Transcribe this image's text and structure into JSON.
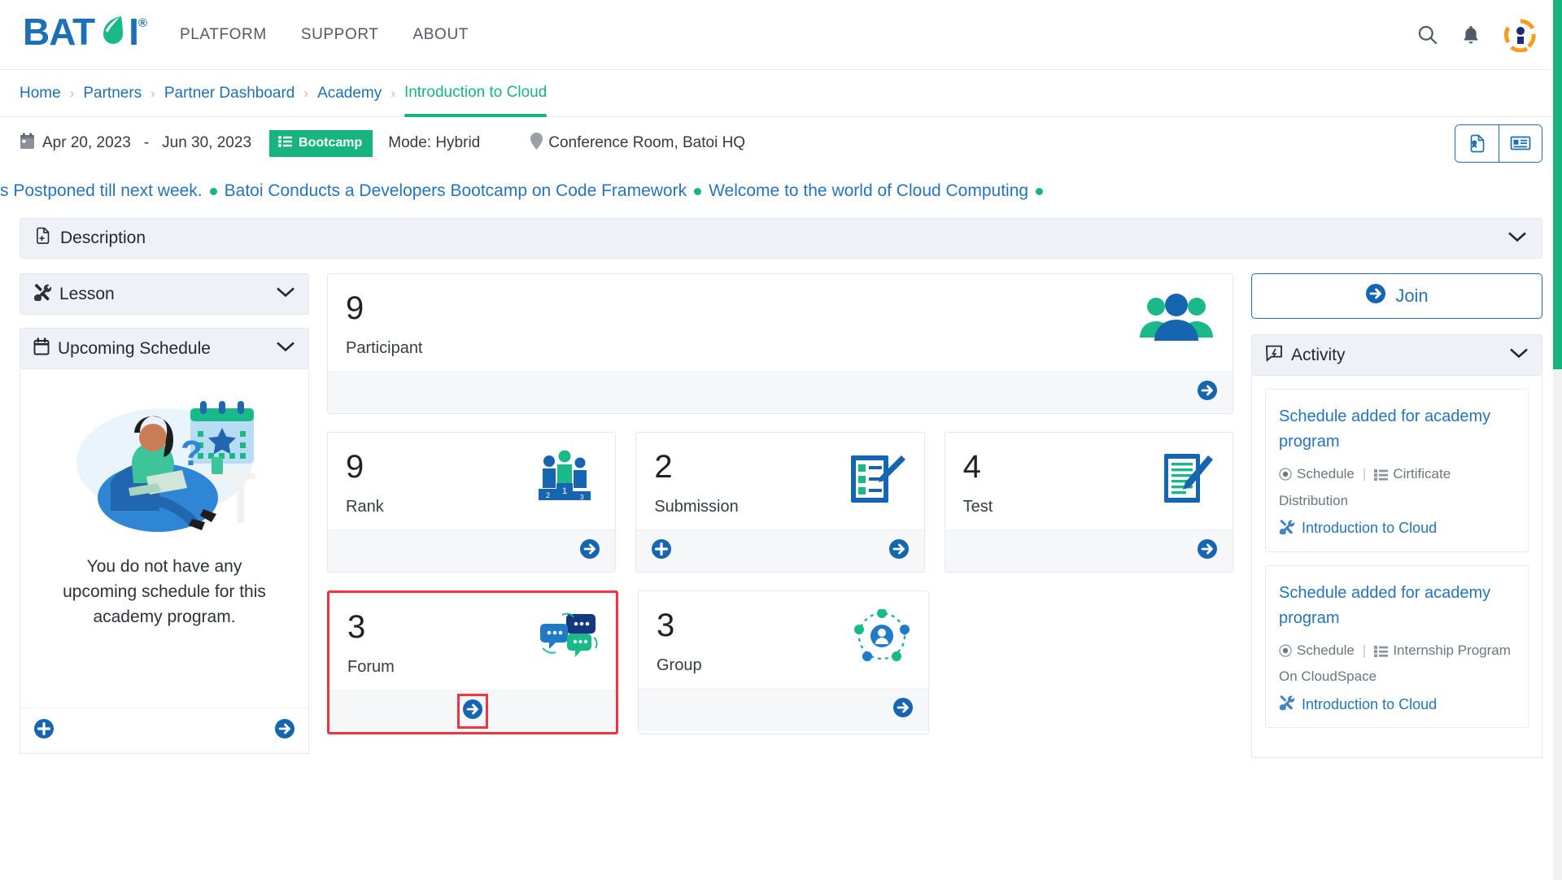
{
  "brand": {
    "name": "BATOI",
    "registered": "®"
  },
  "topnav": {
    "links": [
      {
        "label": "PLATFORM",
        "name": "nav-platform"
      },
      {
        "label": "SUPPORT",
        "name": "nav-support"
      },
      {
        "label": "ABOUT",
        "name": "nav-about"
      }
    ],
    "icons": {
      "search": "search-icon",
      "notification": "bell-icon",
      "avatar": "user-avatar"
    }
  },
  "breadcrumb": {
    "items": [
      "Home",
      "Partners",
      "Partner Dashboard",
      "Academy",
      "Introduction to Cloud"
    ],
    "separator": "›",
    "active_index": 4
  },
  "meta": {
    "start_date": "Apr 20, 2023",
    "dash": "-",
    "end_date": "Jun 30, 2023",
    "badge": "Bootcamp",
    "mode": "Mode: Hybrid",
    "location": "Conference Room, Batoi HQ",
    "actions": [
      {
        "name": "certificate-button",
        "icon": "certificate-icon"
      },
      {
        "name": "newsletter-button",
        "icon": "newspaper-icon"
      }
    ]
  },
  "ticker": {
    "items": [
      "s Postponed till next week.",
      "Batoi Conducts a Developers Bootcamp on Code Framework",
      "Welcome to the world of Cloud Computing"
    ]
  },
  "description_panel": {
    "title": "Description",
    "icon": "file-plus-icon"
  },
  "lesson_panel": {
    "title": "Lesson",
    "icon": "tools-icon"
  },
  "schedule_panel": {
    "title": "Upcoming Schedule",
    "icon": "calendar-icon",
    "empty_message": "You do not have any upcoming schedule for this academy program.",
    "add_button": "add-schedule-button",
    "view_button": "view-schedule-button"
  },
  "stats": {
    "participant": {
      "value": "9",
      "label": "Participant",
      "icon": "people-group-icon",
      "footer": {
        "arrow": true,
        "plus": false
      }
    },
    "row1": [
      {
        "value": "9",
        "label": "Rank",
        "icon": "podium-icon",
        "footer": {
          "arrow": true,
          "plus": false
        }
      },
      {
        "value": "2",
        "label": "Submission",
        "icon": "clipboard-check-icon",
        "footer": {
          "arrow": true,
          "plus": true
        }
      },
      {
        "value": "4",
        "label": "Test",
        "icon": "test-paper-icon",
        "footer": {
          "arrow": true,
          "plus": false
        }
      }
    ],
    "row2": [
      {
        "value": "3",
        "label": "Forum",
        "icon": "chat-bubbles-icon",
        "footer": {
          "arrow": true,
          "plus": false
        },
        "highlighted": true
      },
      {
        "value": "3",
        "label": "Group",
        "icon": "network-group-icon",
        "footer": {
          "arrow": true,
          "plus": false
        },
        "highlighted": false
      }
    ]
  },
  "join": {
    "label": "Join",
    "icon": "arrow-right-circle-icon"
  },
  "activity_panel": {
    "title": "Activity",
    "icon": "activity-comment-icon",
    "cards": [
      {
        "title": "Schedule added for academy program",
        "type": "Schedule",
        "separator": "|",
        "category": "Cirtificate Distribution",
        "program": "Introduction to Cloud"
      },
      {
        "title": "Schedule added for academy program",
        "type": "Schedule",
        "separator": "|",
        "category": "Internship Program On CloudSpace",
        "program": "Introduction to Cloud"
      }
    ]
  },
  "colors": {
    "brand_blue": "#1d6fb8",
    "brand_green": "#17b47f",
    "link_blue": "#2574bb",
    "highlight_red": "#f5333f",
    "panel_bg": "#eef2f7"
  }
}
